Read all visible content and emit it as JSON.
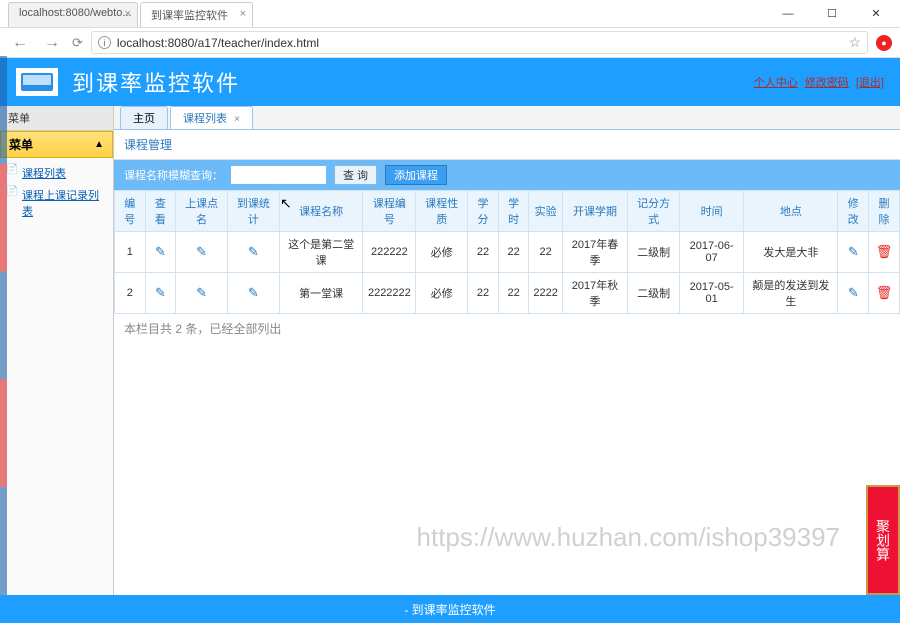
{
  "chrome": {
    "min": "—",
    "max": "☐",
    "close": "✕"
  },
  "browser": {
    "tabs": [
      {
        "title": "localhost:8080/webto..."
      },
      {
        "title": "到课率监控软件"
      }
    ],
    "url": "localhost:8080/a17/teacher/index.html"
  },
  "header": {
    "title": "到课率监控软件",
    "links": {
      "a": "个人中心",
      "b": "修改密码",
      "c": "[退出]"
    }
  },
  "sidebar": {
    "title": "菜单",
    "panel": "菜单",
    "items": [
      "课程列表",
      "课程上课记录列表"
    ]
  },
  "tabs": {
    "home": "主页",
    "list": "课程列表",
    "close": "×"
  },
  "panel": {
    "title": "课程管理"
  },
  "search": {
    "label": "课程名称模糊查询：",
    "placeholder": "",
    "query_btn": "查 询",
    "add_btn": "添加课程"
  },
  "table": {
    "headers": [
      "编号",
      "查看",
      "上课点名",
      "到课统计",
      "课程名称",
      "课程编号",
      "课程性质",
      "学分",
      "学时",
      "实验",
      "开课学期",
      "记分方式",
      "时间",
      "地点",
      "修改",
      "删除"
    ],
    "rows": [
      {
        "no": "1",
        "name": "这个是第二堂课",
        "code": "222222",
        "nature": "必修",
        "credit": "22",
        "hours": "22",
        "lab": "22",
        "term": "2017年春季",
        "grade": "二级制",
        "time": "2017-06-07",
        "place": "发大是大非"
      },
      {
        "no": "2",
        "name": "第一堂课",
        "code": "2222222",
        "nature": "必修",
        "credit": "22",
        "hours": "22",
        "lab": "2222",
        "term": "2017年秋季",
        "grade": "二级制",
        "time": "2017-05-01",
        "place": "颠是的发送到发生"
      }
    ],
    "summary": "本栏目共 2 条，已经全部列出"
  },
  "footer": {
    "text": "- 到课率监控软件"
  },
  "overlay": {
    "watermark": "https://www.huzhan.com/ishop39397",
    "ad": "聚划算"
  }
}
